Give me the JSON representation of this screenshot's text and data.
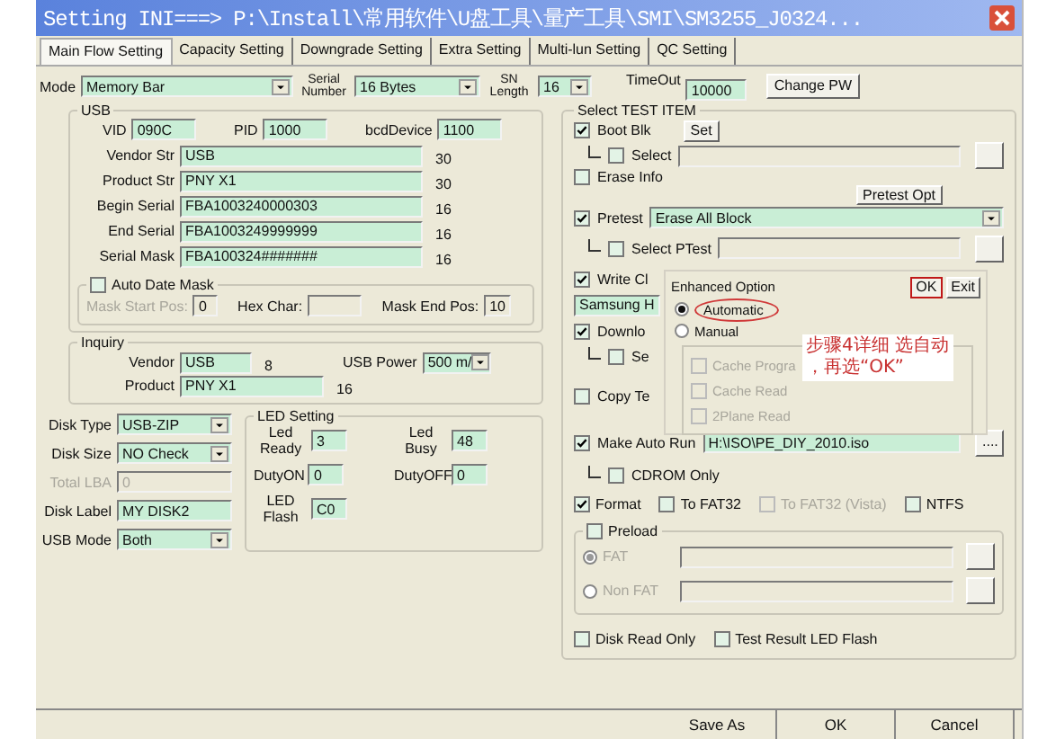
{
  "window": {
    "title": "Setting   INI===> P:\\Install\\常用软件\\U盘工具\\量产工具\\SMI\\SM3255_J0324..."
  },
  "tabs": [
    {
      "label": "Main Flow Setting",
      "selected": true
    },
    {
      "label": "Capacity Setting",
      "selected": false
    },
    {
      "label": "Downgrade Setting",
      "selected": false
    },
    {
      "label": "Extra Setting",
      "selected": false
    },
    {
      "label": "Multi-lun Setting",
      "selected": false
    },
    {
      "label": "QC Setting",
      "selected": false
    }
  ],
  "top_row": {
    "mode": {
      "label": "Mode",
      "value": "Memory Bar"
    },
    "serial_number": {
      "label": "Serial Number",
      "value": "16 Bytes"
    },
    "sn_length": {
      "label": "SN Length",
      "value": "16"
    },
    "timeout": {
      "label": "TimeOut",
      "value": "10000"
    },
    "change_pw": "Change PW"
  },
  "usb": {
    "title": "USB",
    "ids": [
      {
        "label": "VID",
        "value": "090C"
      },
      {
        "label": "PID",
        "value": "1000"
      },
      {
        "label": "bcdDevice",
        "value": "1100"
      }
    ],
    "strings": [
      {
        "label": "Vendor Str",
        "value": "USB",
        "length": "30"
      },
      {
        "label": "Product Str",
        "value": "PNY X1",
        "length": "30"
      },
      {
        "label": "Begin Serial",
        "value": "FBA1003240000303",
        "length": "16"
      },
      {
        "label": "End Serial",
        "value": "FBA1003249999999",
        "length": "16"
      },
      {
        "label": "Serial Mask",
        "value": "FBA100324#######",
        "length": "16"
      }
    ],
    "auto_date_mask": {
      "label": "Auto Date Mask",
      "checked": false,
      "fields": [
        {
          "label": "Mask Start Pos:",
          "value": "0",
          "disabled": true
        },
        {
          "label": "Hex Char:",
          "disabled": false
        },
        {
          "label": "Mask End Pos:",
          "value": "10",
          "disabled": false
        }
      ]
    }
  },
  "inquiry": {
    "title": "Inquiry",
    "vendor": {
      "label": "Vendor",
      "value": "USB",
      "length": "8"
    },
    "usb_power": {
      "label": "USB Power",
      "value": "500 m/"
    },
    "product": {
      "label": "Product",
      "value": "PNY X1",
      "length": "16"
    }
  },
  "disk": [
    {
      "kind": "select",
      "label": "Disk Type",
      "value": "USB-ZIP",
      "disabled": false
    },
    {
      "kind": "select",
      "label": "Disk Size",
      "value": "NO Check",
      "disabled": false
    },
    {
      "kind": "input",
      "label": "Total LBA",
      "value": "0",
      "disabled": true
    },
    {
      "kind": "input",
      "label": "Disk Label",
      "value": "MY DISK2",
      "disabled": false
    },
    {
      "kind": "select",
      "label": "USB Mode",
      "value": "Both",
      "disabled": false
    }
  ],
  "led": {
    "title": "LED Setting",
    "fields": [
      {
        "label": "Led Ready",
        "value": "3"
      },
      {
        "label": "Led Busy",
        "value": "48"
      },
      {
        "label": "DutyON",
        "value": "0"
      },
      {
        "label": "DutyOFF",
        "value": "0"
      },
      {
        "label": "LED Flash",
        "value": "C0"
      }
    ]
  },
  "test_items": {
    "title": "Select TEST ITEM",
    "rows": [
      {
        "kind": "check",
        "label": "Boot Blk",
        "checked": true,
        "button": "Set"
      },
      {
        "kind": "sub_path",
        "label": "Select",
        "checked": false
      },
      {
        "kind": "check",
        "label": "Erase Info",
        "checked": false
      },
      {
        "kind": "button_row",
        "button": "Pretest Opt"
      },
      {
        "kind": "check_select",
        "label": "Pretest",
        "checked": true,
        "value": "Erase All Block"
      },
      {
        "kind": "sub_path",
        "label": "Select PTest",
        "checked": false
      },
      {
        "kind": "check",
        "label": "Write Cl",
        "checked": true
      },
      {
        "kind": "select",
        "value": "Samsung H"
      },
      {
        "kind": "check",
        "label": "Downlo",
        "checked": true
      },
      {
        "kind": "sub_check",
        "label": "Se",
        "checked": false
      },
      {
        "kind": "check",
        "label": "Copy Te",
        "checked": false
      },
      {
        "kind": "check_path",
        "label": "Make Auto Run",
        "checked": true,
        "value": "H:\\ISO\\PE_DIY_2010.iso",
        "browse": "...."
      },
      {
        "kind": "sub_check",
        "label": "CDROM Only",
        "checked": false
      },
      {
        "kind": "checks",
        "items": [
          {
            "label": "Format",
            "checked": true,
            "disabled": false
          },
          {
            "label": "To FAT32",
            "checked": false,
            "disabled": false
          },
          {
            "label": "To FAT32 (Vista)",
            "checked": false,
            "disabled": true
          },
          {
            "label": "NTFS",
            "checked": false,
            "disabled": false
          }
        ]
      },
      {
        "kind": "preload",
        "label": "Preload",
        "checked": false,
        "options": [
          {
            "label": "FAT",
            "selected": true
          },
          {
            "label": "Non FAT",
            "selected": false
          }
        ]
      },
      {
        "kind": "checks",
        "items": [
          {
            "label": "Disk Read Only",
            "checked": false,
            "disabled": false
          },
          {
            "label": "Test Result LED Flash",
            "checked": false,
            "disabled": false
          }
        ]
      }
    ]
  },
  "popup": {
    "title": "Enhanced Option",
    "ok": {
      "label": "OK",
      "boxed": true
    },
    "exit": "Exit",
    "modes": [
      {
        "label": "Automatic",
        "selected": true,
        "circled": true
      },
      {
        "label": "Manual",
        "selected": false,
        "circled": false
      }
    ],
    "options": [
      {
        "label": "Cache Progra",
        "checked": false
      },
      {
        "label": "Cache Read",
        "checked": false
      },
      {
        "label": "2Plane Read",
        "checked": false
      }
    ],
    "annotation": [
      "步骤4详细  选自动",
      "，再选“OK”"
    ]
  },
  "footer": [
    "Save As",
    "OK",
    "Cancel"
  ]
}
